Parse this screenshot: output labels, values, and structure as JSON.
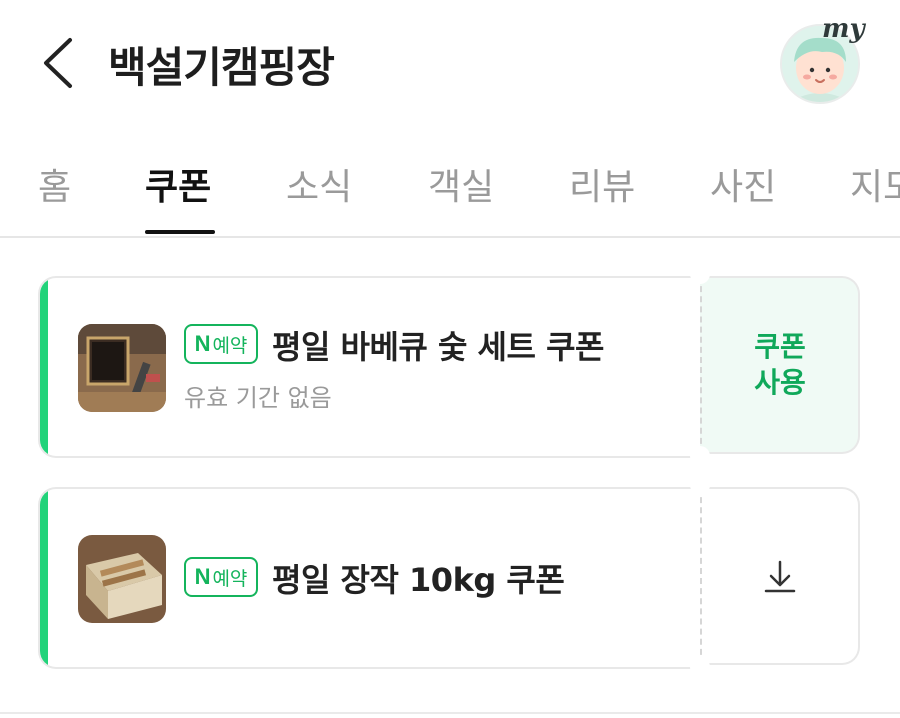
{
  "header": {
    "title": "백설기캠핑장",
    "avatar_label": "my"
  },
  "tabs": [
    {
      "label": "홈",
      "active": false
    },
    {
      "label": "쿠폰",
      "active": true
    },
    {
      "label": "소식",
      "active": false
    },
    {
      "label": "객실",
      "active": false
    },
    {
      "label": "리뷰",
      "active": false
    },
    {
      "label": "사진",
      "active": false
    },
    {
      "label": "지도",
      "active": false
    }
  ],
  "coupons": [
    {
      "badge_n": "N",
      "badge_text": "예약",
      "title": "평일 바베큐 숯 세트 쿠폰",
      "subtitle": "유효 기간 없음",
      "action_label": "쿠폰 사용",
      "action_type": "use"
    },
    {
      "badge_n": "N",
      "badge_text": "예약",
      "title": "평일 장작 10kg 쿠폰",
      "action_icon": "download-icon",
      "action_type": "download"
    }
  ],
  "colors": {
    "accent": "#22d37a",
    "badge_green": "#14b45c",
    "use_text": "#10a85a",
    "use_bg": "#f0faf5"
  }
}
